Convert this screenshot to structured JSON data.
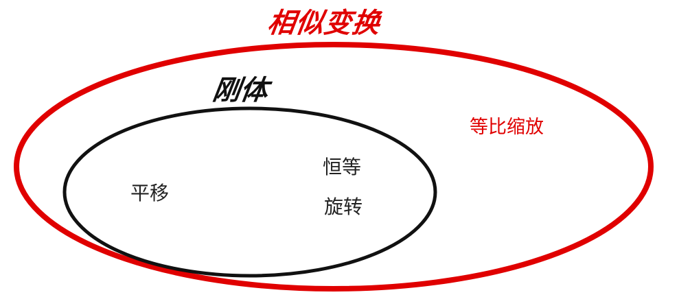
{
  "diagram": {
    "outer_set": {
      "label": "相似变换",
      "member": "等比缩放",
      "color": "#e00000"
    },
    "inner_set": {
      "label": "刚体",
      "members": [
        "平移",
        "恒等",
        "旋转"
      ],
      "color": "#111111"
    }
  }
}
